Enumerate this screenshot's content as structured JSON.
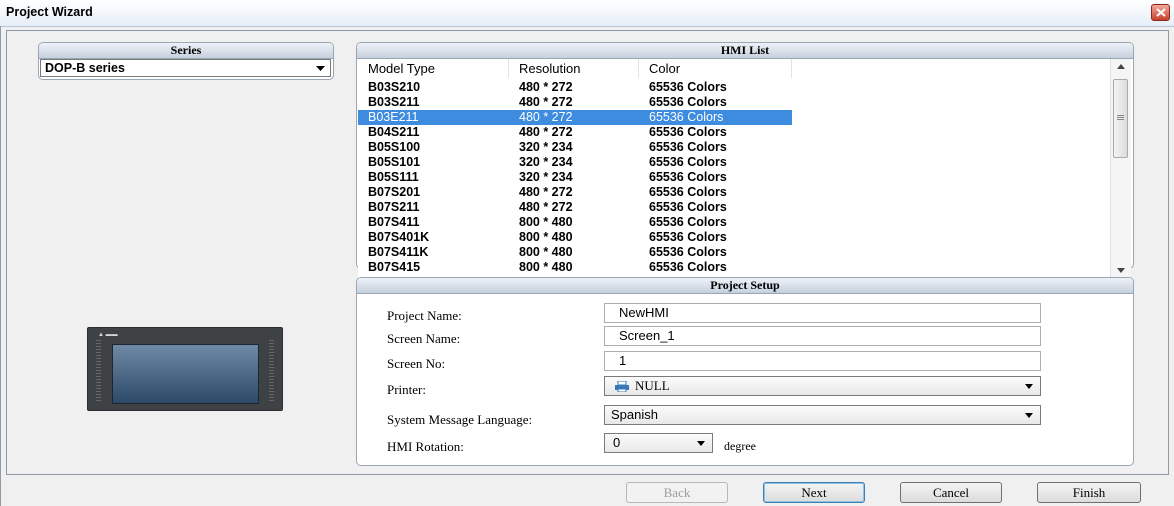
{
  "window": {
    "title": "Project Wizard"
  },
  "series": {
    "header": "Series",
    "selected": "DOP-B series"
  },
  "hmi_list": {
    "header": "HMI List",
    "columns": [
      "Model Type",
      "Resolution",
      "Color"
    ],
    "rows": [
      [
        "B03S210",
        "480 * 272",
        "65536 Colors"
      ],
      [
        "B03S211",
        "480 * 272",
        "65536 Colors"
      ],
      [
        "B03E211",
        "480 * 272",
        "65536 Colors"
      ],
      [
        "B04S211",
        "480 * 272",
        "65536 Colors"
      ],
      [
        "B05S100",
        "320 * 234",
        "65536 Colors"
      ],
      [
        "B05S101",
        "320 * 234",
        "65536 Colors"
      ],
      [
        "B05S111",
        "320 * 234",
        "65536 Colors"
      ],
      [
        "B07S201",
        "480 * 272",
        "65536 Colors"
      ],
      [
        "B07S211",
        "480 * 272",
        "65536 Colors"
      ],
      [
        "B07S411",
        "800 * 480",
        "65536 Colors"
      ],
      [
        "B07S401K",
        "800 * 480",
        "65536 Colors"
      ],
      [
        "B07S411K",
        "800 * 480",
        "65536 Colors"
      ],
      [
        "B07S415",
        "800 * 480",
        "65536 Colors"
      ]
    ],
    "selected_index": 2
  },
  "project_setup": {
    "header": "Project Setup",
    "project_name_label": "Project Name:",
    "project_name_value": "NewHMI",
    "screen_name_label": "Screen Name:",
    "screen_name_value": "Screen_1",
    "screen_no_label": "Screen No:",
    "screen_no_value": "1",
    "printer_label": "Printer:",
    "printer_value": "NULL",
    "language_label": "System Message Language:",
    "language_value": "Spanish",
    "rotation_label": "HMI Rotation:",
    "rotation_value": "0",
    "rotation_unit": "degree"
  },
  "buttons": {
    "back": "Back",
    "next": "Next",
    "cancel": "Cancel",
    "finish": "Finish"
  },
  "icons": {
    "close": "close-icon",
    "printer": "printer-icon",
    "dropdown": "chevron-down-icon"
  },
  "colors": {
    "selection": "#3d8ce0",
    "close_button": "#c7412c"
  }
}
